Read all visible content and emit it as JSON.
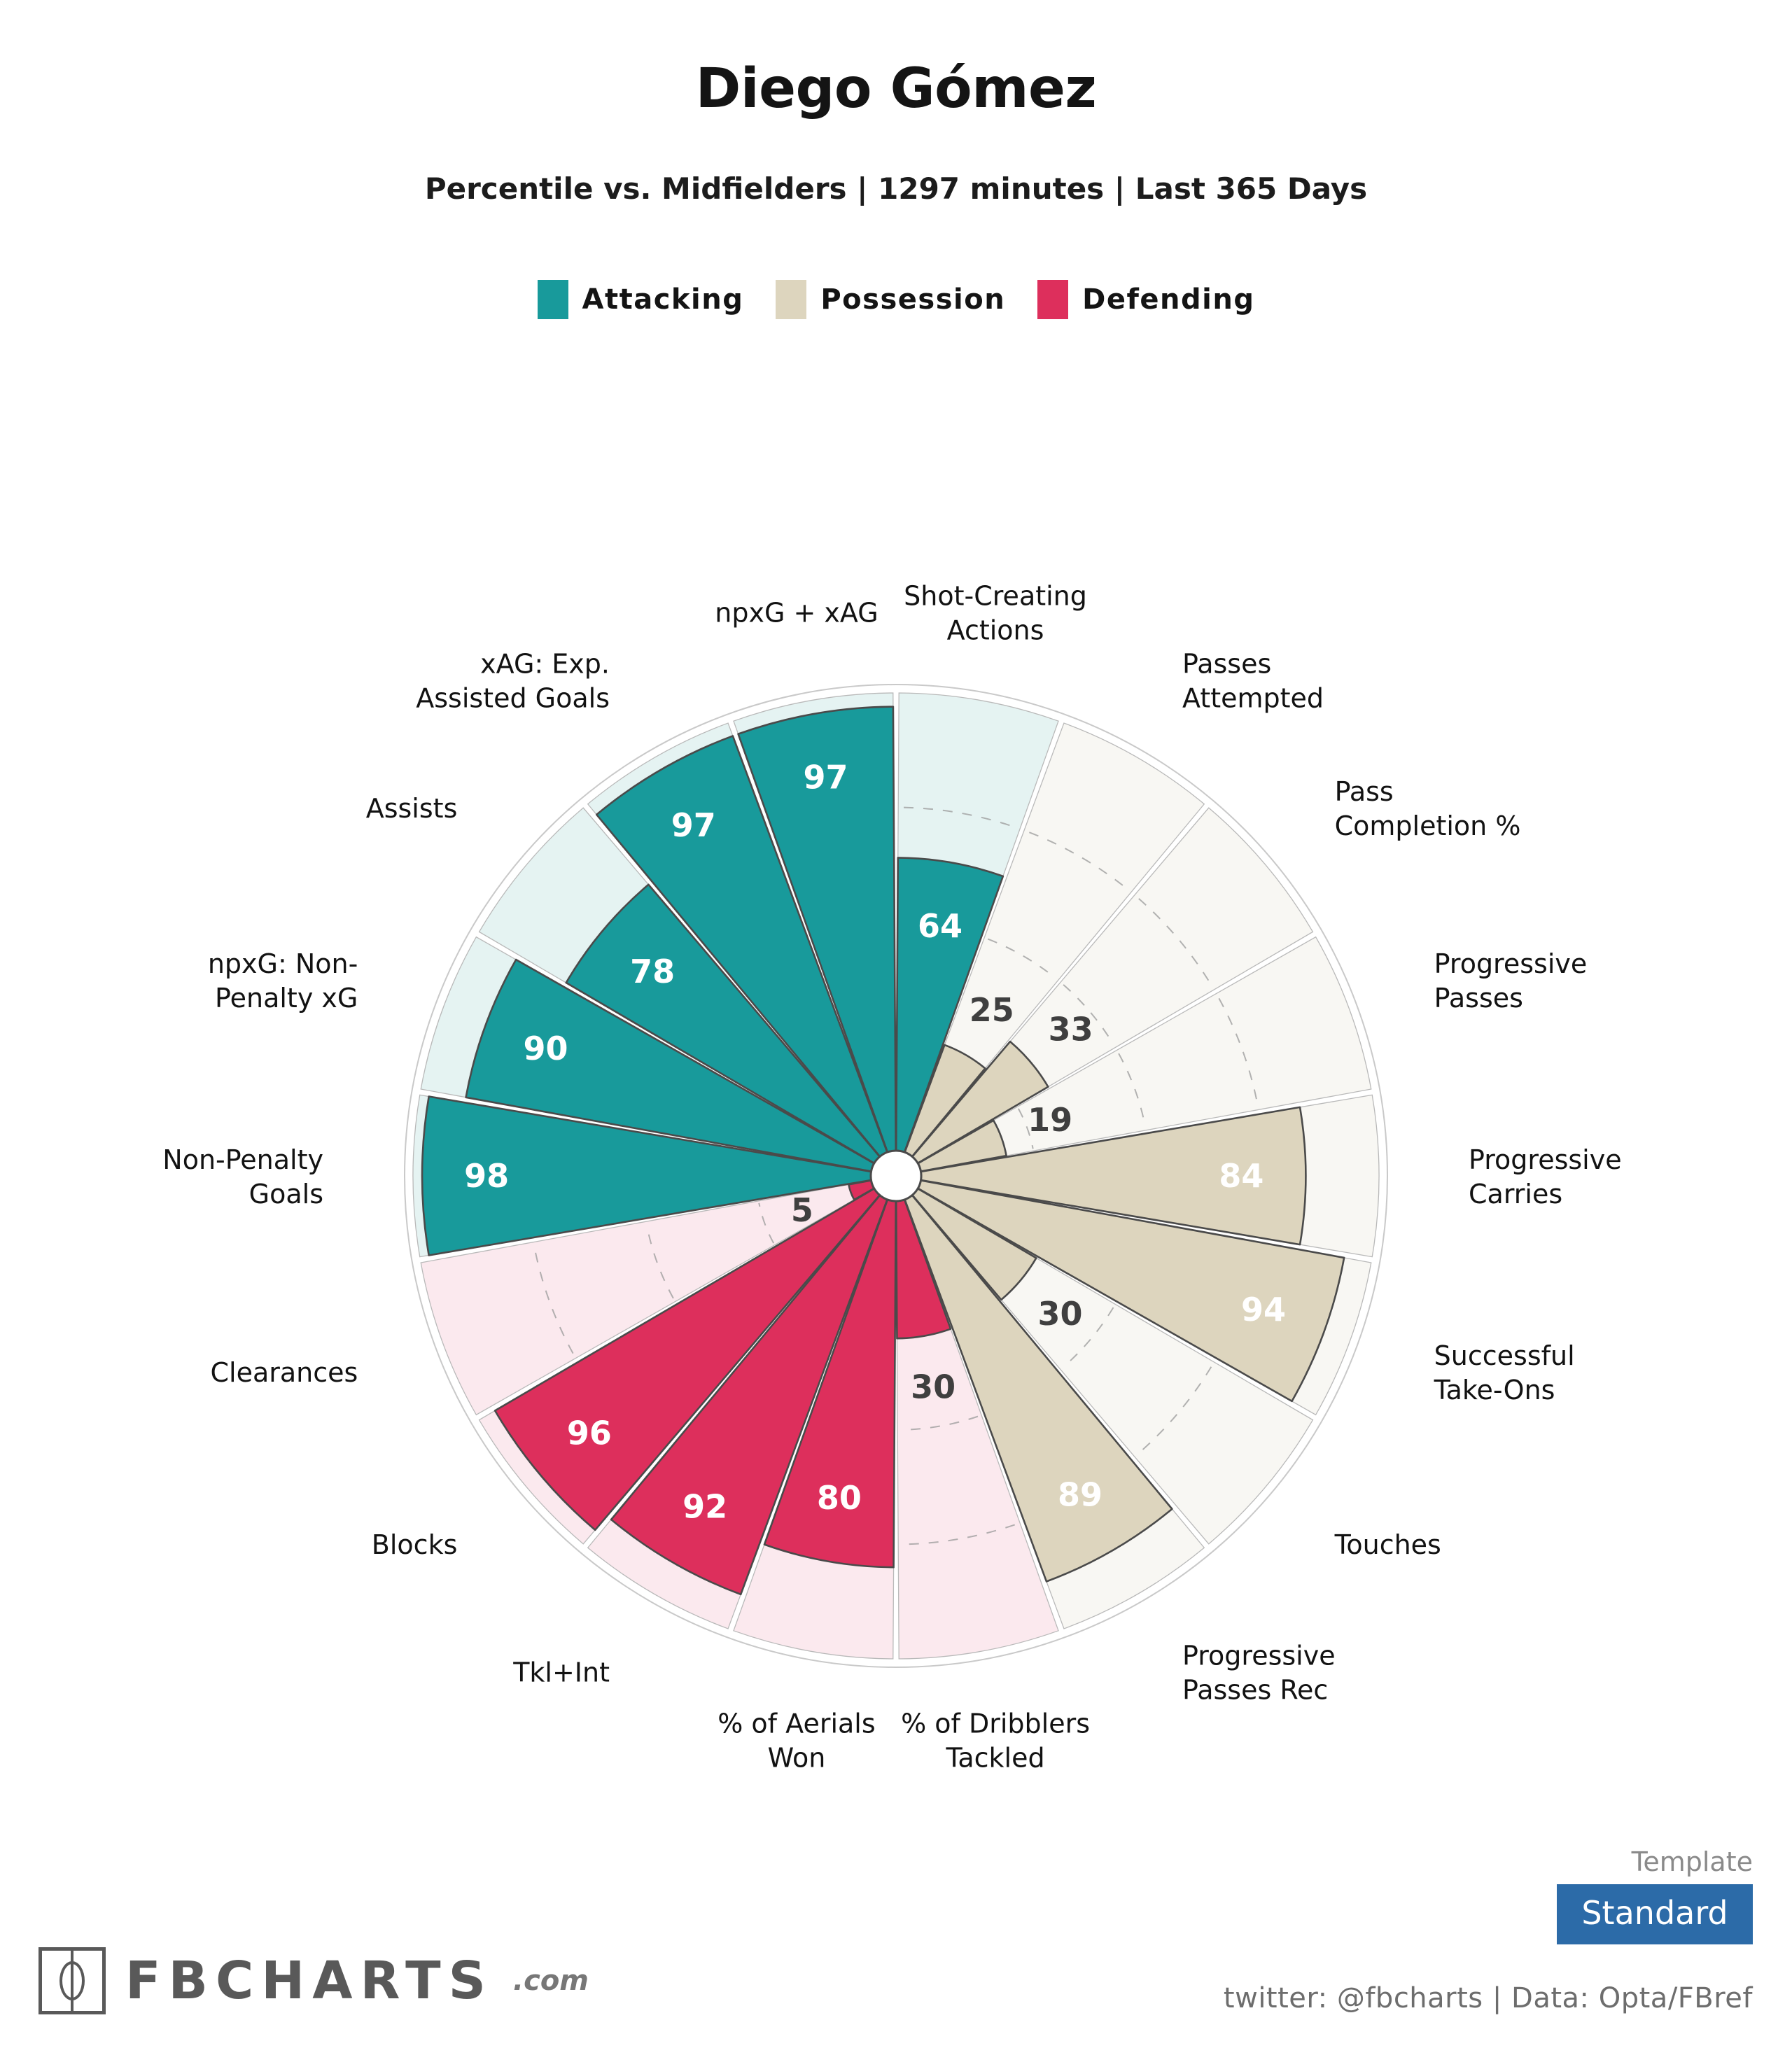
{
  "header": {
    "player_name": "Diego Gómez",
    "subtitle": "Percentile vs. Midfielders | 1297 minutes | Last 365 Days"
  },
  "legend": [
    {
      "label": "Attacking",
      "color": "#189A9B"
    },
    {
      "label": "Possession",
      "color": "#DDD5BE"
    },
    {
      "label": "Defending",
      "color": "#DD2F5C"
    }
  ],
  "colors": {
    "attacking": "#189A9B",
    "attacking_bg": "#E5F3F2",
    "possession": "#DDD5BE",
    "possession_bg": "#F8F7F3",
    "defending": "#DD2F5C",
    "defending_bg": "#FBE9EE",
    "outline": "#4A4A4A",
    "gridline": "#9a9a9a",
    "hub": "#ffffff",
    "template_badge": "#2C6BA8"
  },
  "chart_data": {
    "type": "bar",
    "subtype": "pizza-polar-percentile",
    "title": "Diego Gómez",
    "subtitle": "Percentile vs. Midfielders | 1297 minutes | Last 365 Days",
    "ylim": [
      0,
      100
    ],
    "ylabel": "Percentile",
    "xlabel": "",
    "grid": true,
    "gridlines": [
      25,
      50,
      75
    ],
    "legend_position": "top",
    "start_angle_deg": -90,
    "slice_angle_deg": 20,
    "direction": "clockwise",
    "categories": [
      "Shot-Creating Actions",
      "Passes Attempted",
      "Pass Completion %",
      "Progressive Passes",
      "Progressive Carries",
      "Successful Take-Ons",
      "Touches",
      "Progressive Passes Rec",
      "% of Dribblers Tackled",
      "% of Aerials Won",
      "Tkl+Int",
      "Blocks",
      "Clearances",
      "Non-Penalty Goals",
      "npxG: Non-Penalty xG",
      "Assists",
      "xAG: Exp. Assisted Goals",
      "npxG + xAG"
    ],
    "values": [
      64,
      25,
      33,
      19,
      84,
      94,
      30,
      89,
      30,
      80,
      92,
      96,
      5,
      98,
      90,
      78,
      97,
      97
    ],
    "groups": [
      "Attacking",
      "Possession",
      "Possession",
      "Possession",
      "Possession",
      "Possession",
      "Possession",
      "Possession",
      "Defending",
      "Defending",
      "Defending",
      "Defending",
      "Defending",
      "Attacking",
      "Attacking",
      "Attacking",
      "Attacking",
      "Attacking"
    ],
    "series": [
      {
        "name": "Percentile",
        "points": [
          {
            "label": "Shot-Creating Actions",
            "value": 64,
            "group": "Attacking",
            "label_lines": [
              "Shot-Creating",
              "Actions"
            ]
          },
          {
            "label": "Passes Attempted",
            "value": 25,
            "group": "Possession",
            "label_lines": [
              "Passes",
              "Attempted"
            ]
          },
          {
            "label": "Pass Completion %",
            "value": 33,
            "group": "Possession",
            "label_lines": [
              "Pass",
              "Completion %"
            ]
          },
          {
            "label": "Progressive Passes",
            "value": 19,
            "group": "Possession",
            "label_lines": [
              "Progressive",
              "Passes"
            ]
          },
          {
            "label": "Progressive Carries",
            "value": 84,
            "group": "Possession",
            "label_lines": [
              "Progressive",
              "Carries"
            ]
          },
          {
            "label": "Successful Take-Ons",
            "value": 94,
            "group": "Possession",
            "label_lines": [
              "Successful",
              "Take-Ons"
            ]
          },
          {
            "label": "Touches",
            "value": 30,
            "group": "Possession",
            "label_lines": [
              "Touches"
            ]
          },
          {
            "label": "Progressive Passes Rec",
            "value": 89,
            "group": "Possession",
            "label_lines": [
              "Progressive",
              "Passes Rec"
            ]
          },
          {
            "label": "% of Dribblers Tackled",
            "value": 30,
            "group": "Defending",
            "label_lines": [
              "% of Dribblers",
              "Tackled"
            ]
          },
          {
            "label": "% of Aerials Won",
            "value": 80,
            "group": "Defending",
            "label_lines": [
              "% of Aerials",
              "Won"
            ]
          },
          {
            "label": "Tkl+Int",
            "value": 92,
            "group": "Defending",
            "label_lines": [
              "Tkl+Int"
            ]
          },
          {
            "label": "Blocks",
            "value": 96,
            "group": "Defending",
            "label_lines": [
              "Blocks"
            ]
          },
          {
            "label": "Clearances",
            "value": 5,
            "group": "Defending",
            "label_lines": [
              "Clearances"
            ]
          },
          {
            "label": "Non-Penalty Goals",
            "value": 98,
            "group": "Attacking",
            "label_lines": [
              "Non-Penalty",
              "Goals"
            ]
          },
          {
            "label": "npxG: Non-Penalty xG",
            "value": 90,
            "group": "Attacking",
            "label_lines": [
              "npxG: Non-",
              "Penalty xG"
            ]
          },
          {
            "label": "Assists",
            "value": 78,
            "group": "Attacking",
            "label_lines": [
              "Assists"
            ]
          },
          {
            "label": "xAG: Exp. Assisted Goals",
            "value": 97,
            "group": "Attacking",
            "label_lines": [
              "xAG: Exp.",
              "Assisted Goals"
            ]
          },
          {
            "label": "npxG + xAG",
            "value": 97,
            "group": "Attacking",
            "label_lines": [
              "npxG + xAG"
            ]
          }
        ]
      }
    ]
  },
  "footer": {
    "brand": "FBCHARTS",
    "brand_suffix": ".com",
    "template_caption": "Template",
    "template_value": "Standard",
    "credit": "twitter: @fbcharts | Data: Opta/FBref"
  }
}
